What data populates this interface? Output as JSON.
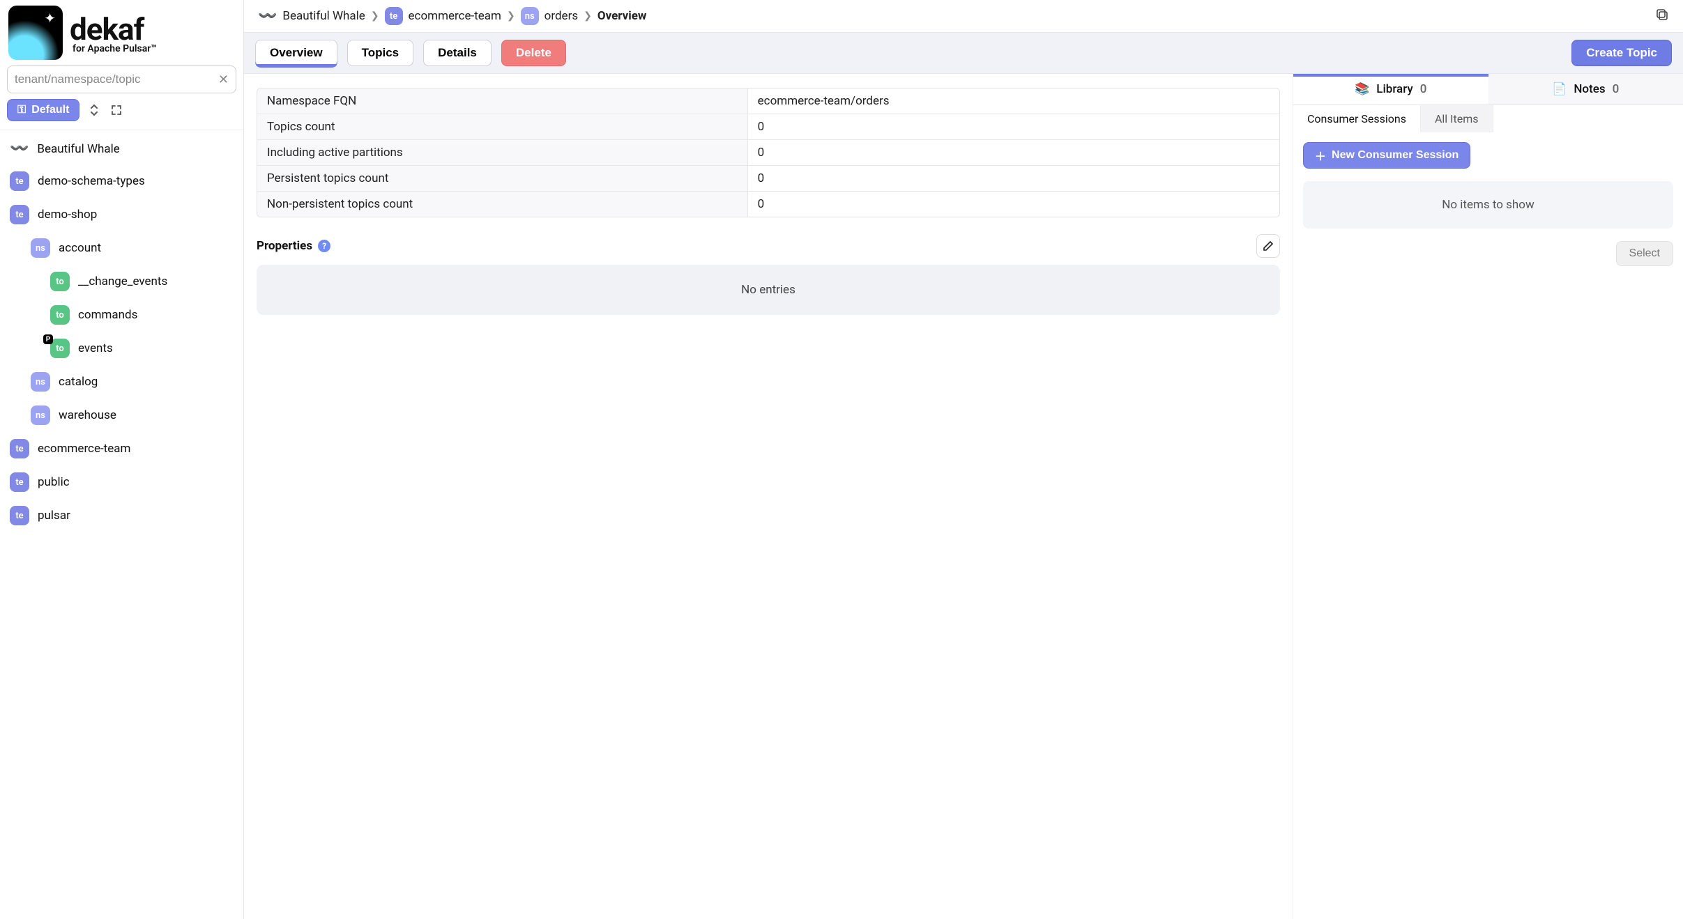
{
  "brand": {
    "name": "dekaf",
    "subtitle": "for Apache Pulsar™"
  },
  "search": {
    "placeholder": "tenant/namespace/topic",
    "value": ""
  },
  "controls": {
    "default_label": "Default"
  },
  "cluster_label": "Beautiful Whale",
  "tree": [
    {
      "type": "te",
      "label": "demo-schema-types"
    },
    {
      "type": "te",
      "label": "demo-shop",
      "children": [
        {
          "type": "ns",
          "label": "account",
          "children": [
            {
              "type": "to",
              "label": "__change_events"
            },
            {
              "type": "to",
              "label": "commands"
            },
            {
              "type": "to",
              "label": "events",
              "partitioned": true
            }
          ]
        },
        {
          "type": "ns",
          "label": "catalog"
        },
        {
          "type": "ns",
          "label": "warehouse"
        }
      ]
    },
    {
      "type": "te",
      "label": "ecommerce-team"
    },
    {
      "type": "te",
      "label": "public"
    },
    {
      "type": "te",
      "label": "pulsar"
    }
  ],
  "breadcrumb": {
    "cluster": "Beautiful Whale",
    "tenant": "ecommerce-team",
    "namespace": "orders",
    "page": "Overview"
  },
  "badges": {
    "te": "te",
    "ns": "ns",
    "to": "to",
    "partition": "P"
  },
  "toolbar": {
    "overview": "Overview",
    "topics": "Topics",
    "details": "Details",
    "delete": "Delete",
    "create_topic": "Create Topic"
  },
  "details": [
    {
      "k": "Namespace FQN",
      "v": "ecommerce-team/orders"
    },
    {
      "k": "Topics count",
      "v": "0"
    },
    {
      "k": "Including active partitions",
      "v": "0"
    },
    {
      "k": "Persistent topics count",
      "v": "0"
    },
    {
      "k": "Non-persistent topics count",
      "v": "0"
    }
  ],
  "properties": {
    "title": "Properties",
    "empty": "No entries"
  },
  "right": {
    "tabs": {
      "library": "Library",
      "library_count": "0",
      "notes": "Notes",
      "notes_count": "0"
    },
    "subtabs": {
      "consumer": "Consumer Sessions",
      "all": "All Items"
    },
    "new_session": "New Consumer Session",
    "empty": "No items to show",
    "select": "Select"
  }
}
